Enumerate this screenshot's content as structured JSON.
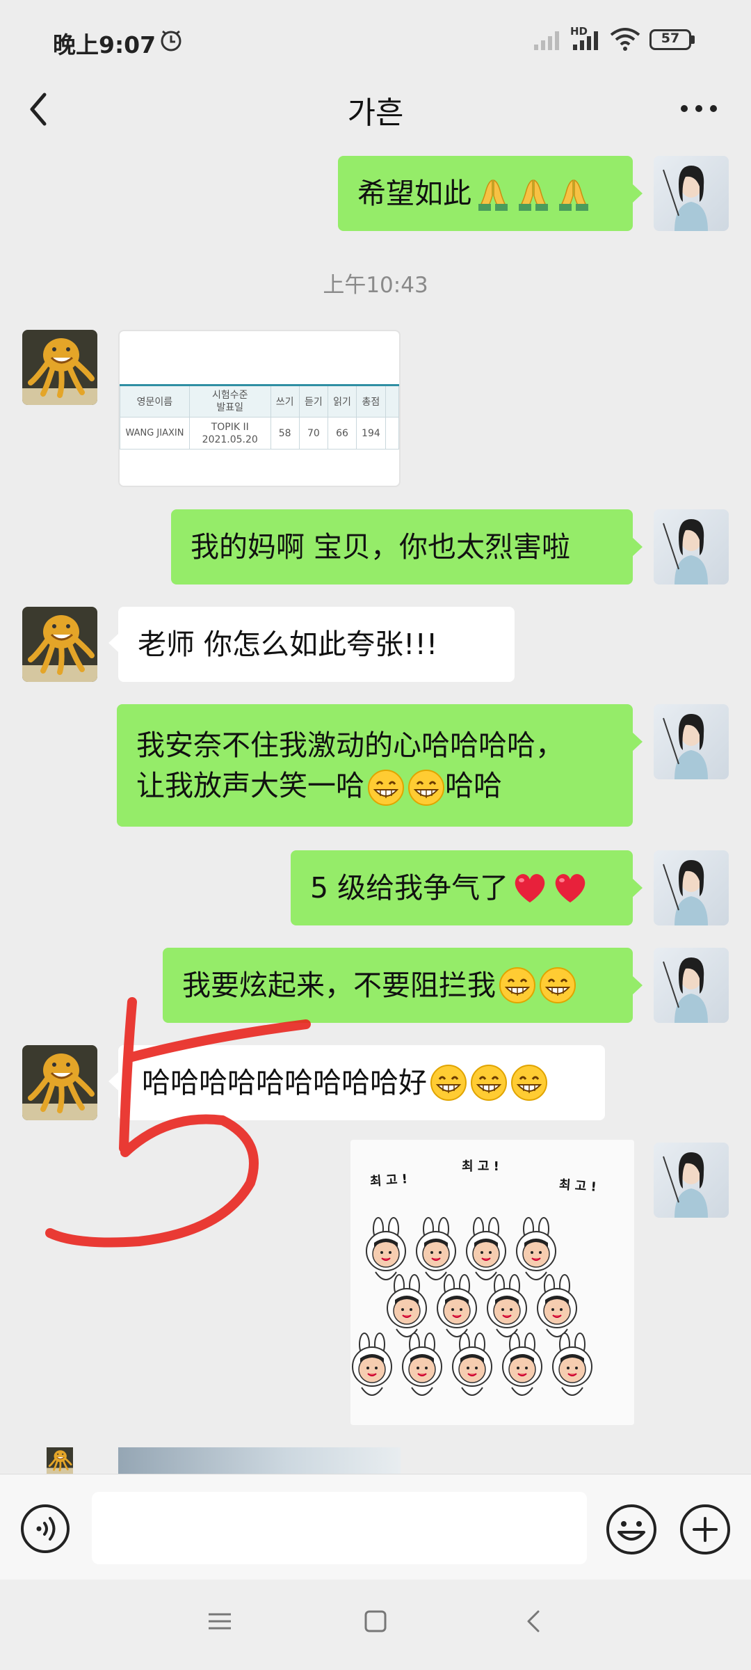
{
  "status_bar": {
    "time": "晚上9:07",
    "network_label": "HD",
    "battery": "57"
  },
  "header": {
    "title": "가흔"
  },
  "messages": [
    {
      "side": "right",
      "text": "希望如此"
    },
    {
      "side": "center",
      "text": "上午10:43"
    },
    {
      "side": "left",
      "type": "image"
    },
    {
      "side": "right",
      "text": "我的妈啊 宝贝，你也太烈害啦"
    },
    {
      "side": "left",
      "text": "老师 你怎么如此夸张!!!"
    },
    {
      "side": "right",
      "line1": "我安奈不住我激动的心哈哈哈哈，",
      "line2_a": "让我放声大笑一哈",
      "line2_b": "哈哈"
    },
    {
      "side": "right",
      "text": "5 级给我争气了"
    },
    {
      "side": "right",
      "text": "我要炫起来，不要阻拦我"
    },
    {
      "side": "left",
      "text": "哈哈哈哈哈哈哈哈哈好"
    },
    {
      "side": "right",
      "type": "sticker"
    }
  ],
  "score_image": {
    "headers": [
      "영문이름",
      "시험수준",
      "발표일",
      "쓰기",
      "듣기",
      "읽기",
      "총점"
    ],
    "name": "WANG JIAXIN",
    "level": "TOPIK II",
    "date": "2021.05.20",
    "writing": "58",
    "listening": "70",
    "reading": "66",
    "total": "194"
  },
  "sticker": {
    "text1": "최 고 !",
    "text2": "최 고 !",
    "text3": "최 고 !"
  },
  "icons": {
    "prayer": "folded-hands-emoji",
    "grin": "grinning-face-emoji",
    "heart": "red-heart-emoji"
  },
  "colors": {
    "sent_bubble": "#95ec69",
    "received_bubble": "#ffffff",
    "background": "#ededed",
    "annotation": "#e8261f"
  }
}
